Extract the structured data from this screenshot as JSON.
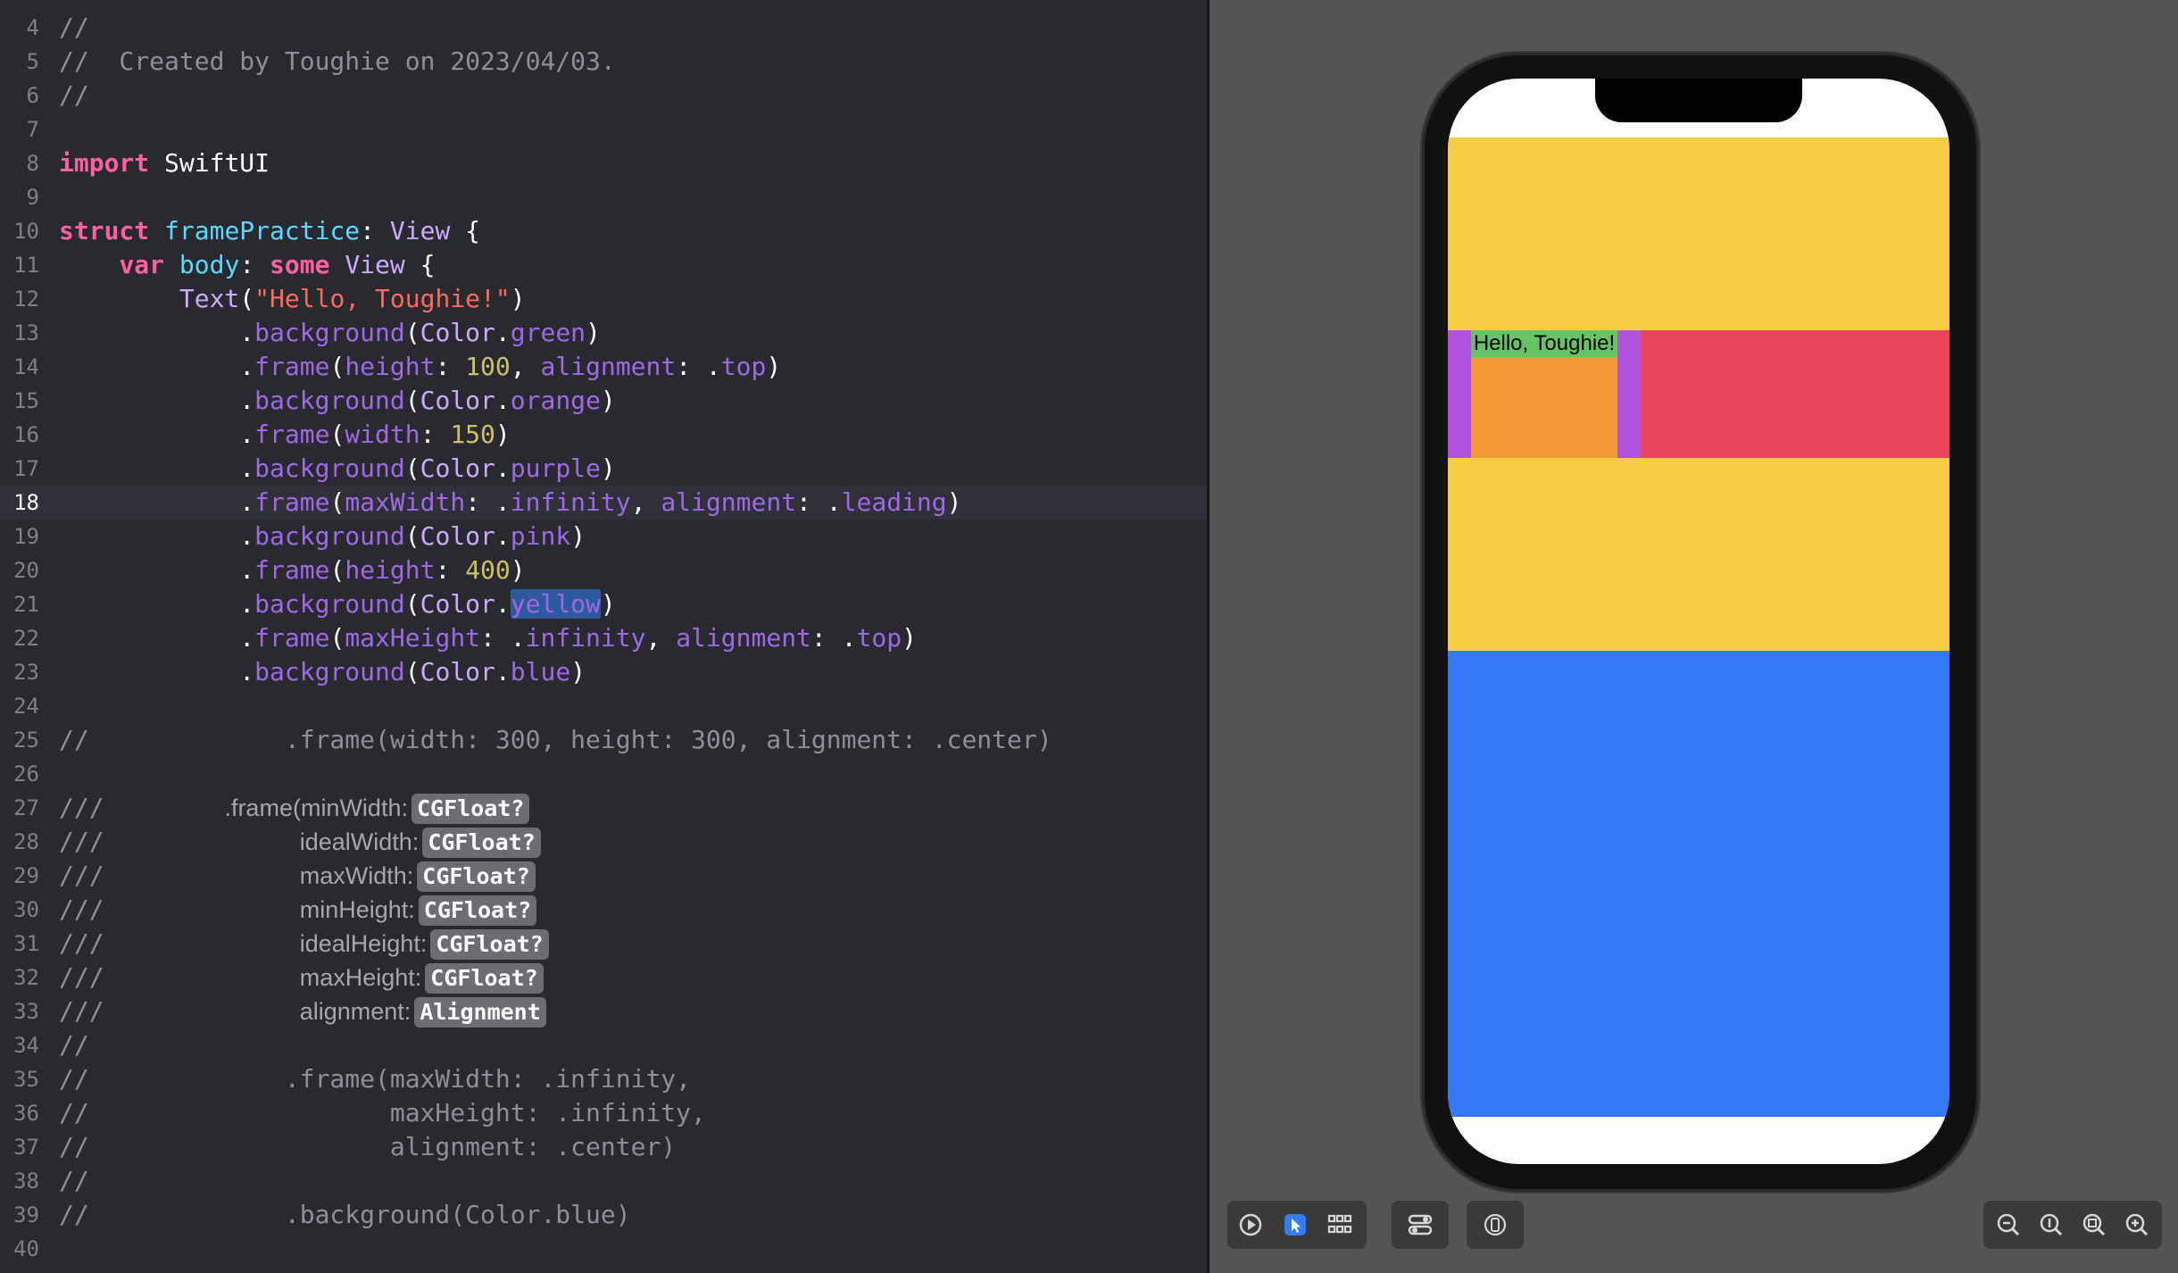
{
  "editor": {
    "lines": [
      {
        "num": "4",
        "code": "<span class='cmt'>//</span>"
      },
      {
        "num": "5",
        "code": "<span class='cmt'>//  Created by Toughie on 2023/04/03.</span>"
      },
      {
        "num": "6",
        "code": "<span class='cmt'>//</span>"
      },
      {
        "num": "7",
        "code": ""
      },
      {
        "num": "8",
        "code": "<span class='kw'>import</span> SwiftUI"
      },
      {
        "num": "9",
        "code": ""
      },
      {
        "num": "10",
        "code": "<span class='kw'>struct</span> <span class='ty'>framePractice</span>: <span class='ty2'>View</span> {"
      },
      {
        "num": "11",
        "code": "    <span class='kw'>var</span> <span class='ty'>body</span>: <span class='kw'>some</span> <span class='ty2'>View</span> {"
      },
      {
        "num": "12",
        "code": "        <span class='ty2'>Text</span>(<span class='str'>\"Hello, Toughie!\"</span>)"
      },
      {
        "num": "13",
        "code": "            .<span class='prop'>background</span>(<span class='ty2'>Color</span>.<span class='prop'>green</span>)"
      },
      {
        "num": "14",
        "code": "            .<span class='prop'>frame</span>(<span class='prop'>height</span>: <span class='num'>100</span>, <span class='prop'>alignment</span>: .<span class='prop'>top</span>)"
      },
      {
        "num": "15",
        "code": "            .<span class='prop'>background</span>(<span class='ty2'>Color</span>.<span class='prop'>orange</span>)"
      },
      {
        "num": "16",
        "code": "            .<span class='prop'>frame</span>(<span class='prop'>width</span>: <span class='num'>150</span>)"
      },
      {
        "num": "17",
        "code": "            .<span class='prop'>background</span>(<span class='ty2'>Color</span>.<span class='prop'>purple</span>)"
      },
      {
        "num": "18",
        "code": "            .<span class='prop'>frame</span>(<span class='prop'>maxWidth</span>: .<span class='prop'>infinity</span>, <span class='prop'>alignment</span>: .<span class='prop'>leading</span>)",
        "current": true
      },
      {
        "num": "19",
        "code": "            .<span class='prop'>background</span>(<span class='ty2'>Color</span>.<span class='prop'>pink</span>)"
      },
      {
        "num": "20",
        "code": "            .<span class='prop'>frame</span>(<span class='prop'>height</span>: <span class='num'>400</span>)"
      },
      {
        "num": "21",
        "code": "            .<span class='prop'>background</span>(<span class='ty2'>Color</span>.<span class='prop sel'>yellow</span>)"
      },
      {
        "num": "22",
        "code": "            .<span class='prop'>frame</span>(<span class='prop'>maxHeight</span>: .<span class='prop'>infinity</span>, <span class='prop'>alignment</span>: .<span class='prop'>top</span>)"
      },
      {
        "num": "23",
        "code": "            .<span class='prop'>background</span>(<span class='ty2'>Color</span>.<span class='prop'>blue</span>)"
      },
      {
        "num": "24",
        "code": ""
      },
      {
        "num": "25",
        "code": "<span class='cmt'>//             .frame(width: 300, height: 300, alignment: .center)</span>"
      },
      {
        "num": "26",
        "code": ""
      },
      {
        "num": "27",
        "code": "<span class='cmt'>///</span>        <span class='doc'>.frame(minWidth:<span class='tok'>CGFloat?</span></span>"
      },
      {
        "num": "28",
        "code": "<span class='cmt'>///</span>             <span class='doc'>idealWidth:<span class='tok'>CGFloat?</span></span>"
      },
      {
        "num": "29",
        "code": "<span class='cmt'>///</span>             <span class='doc'>maxWidth:<span class='tok'>CGFloat?</span></span>"
      },
      {
        "num": "30",
        "code": "<span class='cmt'>///</span>             <span class='doc'>minHeight:<span class='tok'>CGFloat?</span></span>"
      },
      {
        "num": "31",
        "code": "<span class='cmt'>///</span>             <span class='doc'>idealHeight:<span class='tok'>CGFloat?</span></span>"
      },
      {
        "num": "32",
        "code": "<span class='cmt'>///</span>             <span class='doc'>maxHeight:<span class='tok'>CGFloat?</span></span>"
      },
      {
        "num": "33",
        "code": "<span class='cmt'>///</span>             <span class='doc'>alignment:<span class='tok'>Alignment</span></span>"
      },
      {
        "num": "34",
        "code": "<span class='cmt'>//</span>"
      },
      {
        "num": "35",
        "code": "<span class='cmt'>//             .frame(maxWidth: .infinity,</span>"
      },
      {
        "num": "36",
        "code": "<span class='cmt'>//                    maxHeight: .infinity,</span>"
      },
      {
        "num": "37",
        "code": "<span class='cmt'>//                    alignment: .center)</span>"
      },
      {
        "num": "38",
        "code": "<span class='cmt'>//</span>"
      },
      {
        "num": "39",
        "code": "<span class='cmt'>//             .background(Color.blue)</span>"
      },
      {
        "num": "40",
        "code": ""
      }
    ]
  },
  "preview": {
    "text": "Hello, Toughie!",
    "colors": {
      "yellow": "#f6cc45",
      "blue": "#3478f6",
      "pink": "#e9455a",
      "purple": "#af52de",
      "orange": "#f19a37",
      "green": "#65c466"
    }
  },
  "toolbar": {
    "left_icons": [
      "play-icon",
      "select-icon",
      "grid-icon"
    ],
    "variants_icon": "variants-icon",
    "device_icon": "device-settings-icon",
    "zoom_icons": [
      "zoom-out-icon",
      "zoom-actual-icon",
      "zoom-fit-icon",
      "zoom-in-icon"
    ]
  }
}
